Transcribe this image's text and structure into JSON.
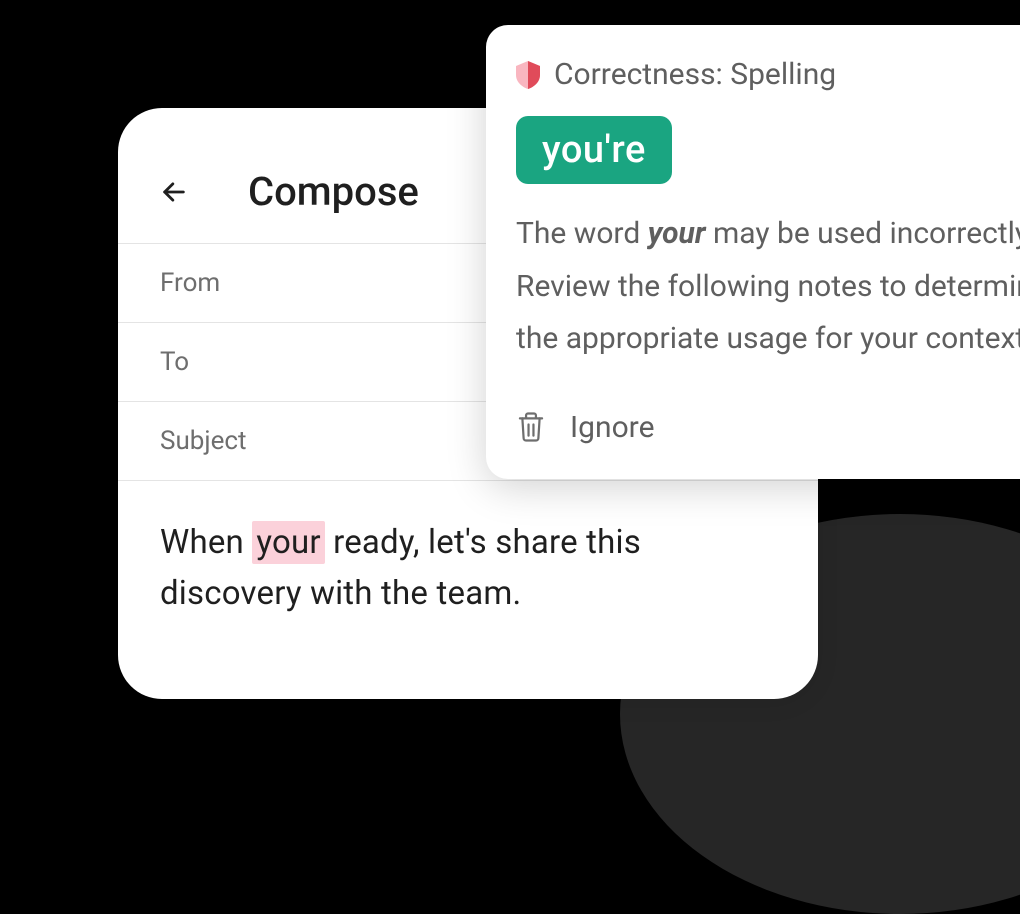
{
  "compose": {
    "title": "Compose",
    "fields": {
      "from": "From",
      "to": "To",
      "subject": "Subject"
    },
    "body": {
      "before": "When ",
      "highlighted": "your",
      "after": " ready, let's share this discovery with the team."
    }
  },
  "suggestion": {
    "category": "Correctness: Spelling",
    "replacement": "you're",
    "description_before": "The word ",
    "description_em": "your",
    "description_after": " may be used incorrectly. Review the following notes to determine the appropriate usage for your context.",
    "ignore_label": "Ignore"
  },
  "icons": {
    "back": "back-arrow-icon",
    "shield": "shield-icon",
    "trash": "trash-icon"
  },
  "colors": {
    "accent_green": "#1aa581",
    "highlight_pink": "#fbd1da",
    "mid_gray": "#5f5f5f"
  }
}
